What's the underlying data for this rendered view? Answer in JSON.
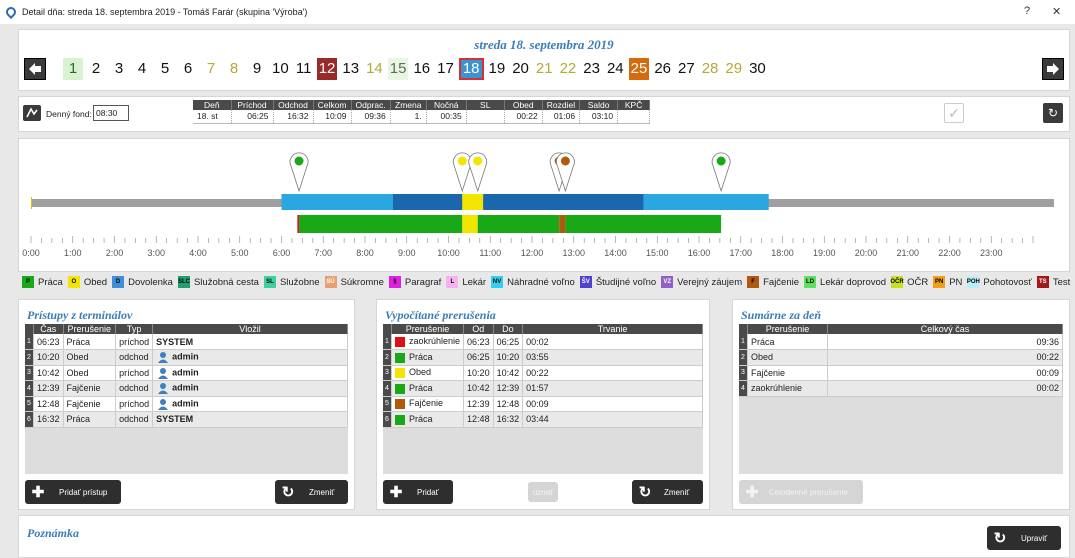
{
  "window": {
    "title": "Detail dňa: streda 18. septembra 2019 - Tomáš Farár  (skupina 'Výroba')",
    "help": "?",
    "close": "✕"
  },
  "date_header": "streda 18. septembra 2019",
  "days": [
    {
      "n": "1",
      "s": "g"
    },
    {
      "n": "2",
      "s": ""
    },
    {
      "n": "3",
      "s": ""
    },
    {
      "n": "4",
      "s": ""
    },
    {
      "n": "5",
      "s": ""
    },
    {
      "n": "6",
      "s": ""
    },
    {
      "n": "7",
      "s": "y"
    },
    {
      "n": "8",
      "s": "y"
    },
    {
      "n": "9",
      "s": ""
    },
    {
      "n": "10",
      "s": ""
    },
    {
      "n": "11",
      "s": ""
    },
    {
      "n": "12",
      "s": "red"
    },
    {
      "n": "13",
      "s": ""
    },
    {
      "n": "14",
      "s": "y"
    },
    {
      "n": "15",
      "s": "gl"
    },
    {
      "n": "16",
      "s": ""
    },
    {
      "n": "17",
      "s": ""
    },
    {
      "n": "18",
      "s": "sel"
    },
    {
      "n": "19",
      "s": ""
    },
    {
      "n": "20",
      "s": ""
    },
    {
      "n": "21",
      "s": "y"
    },
    {
      "n": "22",
      "s": "y"
    },
    {
      "n": "23",
      "s": ""
    },
    {
      "n": "24",
      "s": ""
    },
    {
      "n": "25",
      "s": "org"
    },
    {
      "n": "26",
      "s": ""
    },
    {
      "n": "27",
      "s": ""
    },
    {
      "n": "28",
      "s": "y"
    },
    {
      "n": "29",
      "s": "y"
    },
    {
      "n": "30",
      "s": ""
    }
  ],
  "fund": {
    "label": "Denný fond:",
    "value": "08:30"
  },
  "summary": {
    "headers": [
      "Deň",
      "Príchod",
      "Odchod",
      "Celkom",
      "Odprac.",
      "Zmena",
      "Nočná",
      "SL",
      "Obed",
      "Rozdiel",
      "Saldo",
      "KPČ"
    ],
    "row": [
      "18. st",
      "06:25",
      "16:32",
      "10:09",
      "09:36",
      "1.",
      "00:35",
      "",
      "00:22",
      "01:06",
      "03:10",
      ""
    ]
  },
  "timeline": {
    "hours": [
      "0:00",
      "1:00",
      "2:00",
      "3:00",
      "4:00",
      "5:00",
      "6:00",
      "7:00",
      "8:00",
      "9:00",
      "10:00",
      "11:00",
      "12:00",
      "13:00",
      "14:00",
      "15:00",
      "16:00",
      "17:00",
      "18:00",
      "19:00",
      "20:00",
      "21:00",
      "22:00",
      "23:00"
    ],
    "plan": [
      {
        "from": 6.0,
        "to": 8.67,
        "c": "#2aa7e0"
      },
      {
        "from": 8.67,
        "to": 10.33,
        "c": "#1a67ad"
      },
      {
        "from": 10.33,
        "to": 10.83,
        "c": "#f2e600"
      },
      {
        "from": 10.83,
        "to": 14.67,
        "c": "#1a67ad"
      },
      {
        "from": 14.67,
        "to": 17.67,
        "c": "#2aa7e0"
      }
    ],
    "actual": [
      {
        "from": 6.38,
        "to": 6.42,
        "c": "#e01010"
      },
      {
        "from": 6.42,
        "to": 10.33,
        "c": "#18a818"
      },
      {
        "from": 10.33,
        "to": 10.7,
        "c": "#f2e600"
      },
      {
        "from": 10.7,
        "to": 12.65,
        "c": "#18a818"
      },
      {
        "from": 12.65,
        "to": 12.8,
        "c": "#b05a10"
      },
      {
        "from": 12.8,
        "to": 16.53,
        "c": "#18a818"
      }
    ],
    "pins": [
      {
        "t": 6.42,
        "c": "#18a818"
      },
      {
        "t": 10.33,
        "c": "#f2e600"
      },
      {
        "t": 10.7,
        "c": "#f2e600"
      },
      {
        "t": 12.65,
        "c": "#b05a10"
      },
      {
        "t": 12.8,
        "c": "#b05a10"
      },
      {
        "t": 16.53,
        "c": "#18a818"
      }
    ]
  },
  "legend": [
    {
      "code": "P",
      "label": "Práca",
      "color": "#18a818"
    },
    {
      "code": "O",
      "label": "Obed",
      "color": "#f2e600"
    },
    {
      "code": "D",
      "label": "Dovolenka",
      "color": "#3f8fd8"
    },
    {
      "code": "SLC",
      "label": "Služobná cesta",
      "color": "#20a070"
    },
    {
      "code": "SL",
      "label": "Služobne",
      "color": "#3fd0a0"
    },
    {
      "code": "SÚ",
      "label": "Súkromne",
      "color": "#e8a070"
    },
    {
      "code": "§",
      "label": "Paragraf",
      "color": "#e020e0"
    },
    {
      "code": "L",
      "label": "Lekár",
      "color": "#f8b0f0"
    },
    {
      "code": "NV",
      "label": "Náhradné voľno",
      "color": "#30d0f0"
    },
    {
      "code": "ŠV",
      "label": "Študijné voľno",
      "color": "#5040d0"
    },
    {
      "code": "VZ",
      "label": "Verejný záujem",
      "color": "#9060c8"
    },
    {
      "code": "F",
      "label": "Fajčenie",
      "color": "#b05a10"
    },
    {
      "code": "LD",
      "label": "Lekár doprovod",
      "color": "#60e060"
    },
    {
      "code": "OČR",
      "label": "OČR",
      "color": "#c8e020"
    },
    {
      "code": "PN",
      "label": "PN",
      "color": "#f0a010"
    },
    {
      "code": "POH",
      "label": "Pohotovosť",
      "color": "#b8f0f8"
    },
    {
      "code": "TS",
      "label": "Test",
      "color": "#a01818"
    }
  ],
  "terminals": {
    "title": "Prístupy z terminálov",
    "headers": [
      "Čas",
      "Prerušenie",
      "Typ",
      "Vložil"
    ],
    "rows": [
      [
        "06:23",
        "Práca",
        "príchod",
        "SYSTEM",
        false
      ],
      [
        "10:20",
        "Obed",
        "odchod",
        "admin",
        true
      ],
      [
        "10:42",
        "Obed",
        "príchod",
        "admin",
        true
      ],
      [
        "12:39",
        "Fajčenie",
        "odchod",
        "admin",
        true
      ],
      [
        "12:48",
        "Fajčenie",
        "príchod",
        "admin",
        true
      ],
      [
        "16:32",
        "Práca",
        "odchod",
        "SYSTEM",
        false
      ]
    ],
    "add": "Pridať prístup",
    "change": "Zmeniť"
  },
  "computed": {
    "title": "Vypočítané prerušenia",
    "headers": [
      "Prerušenie",
      "Od",
      "Do",
      "Trvanie"
    ],
    "rows": [
      [
        "#e01010",
        "zaokrúhlenie",
        "06:23",
        "06:25",
        "00:02"
      ],
      [
        "#18a818",
        "Práca",
        "06:25",
        "10:20",
        "03:55"
      ],
      [
        "#f2e600",
        "Obed",
        "10:20",
        "10:42",
        "00:22"
      ],
      [
        "#18a818",
        "Práca",
        "10:42",
        "12:39",
        "01:57"
      ],
      [
        "#b05a10",
        "Fajčenie",
        "12:39",
        "12:48",
        "00:09"
      ],
      [
        "#18a818",
        "Práca",
        "12:48",
        "16:32",
        "03:44"
      ]
    ],
    "add": "Pridať",
    "approve": "uznať",
    "change": "Zmeniť"
  },
  "daily": {
    "title": "Sumárne za deň",
    "headers": [
      "Prerušenie",
      "Celkový čas"
    ],
    "rows": [
      [
        "Práca",
        "09:36"
      ],
      [
        "Obed",
        "00:22"
      ],
      [
        "Fajčenie",
        "00:09"
      ],
      [
        "zaokrúhlenie",
        "00:02"
      ]
    ],
    "allday": "Celodenné prerušenie"
  },
  "note": {
    "title": "Poznámka",
    "edit": "Upraviť"
  }
}
